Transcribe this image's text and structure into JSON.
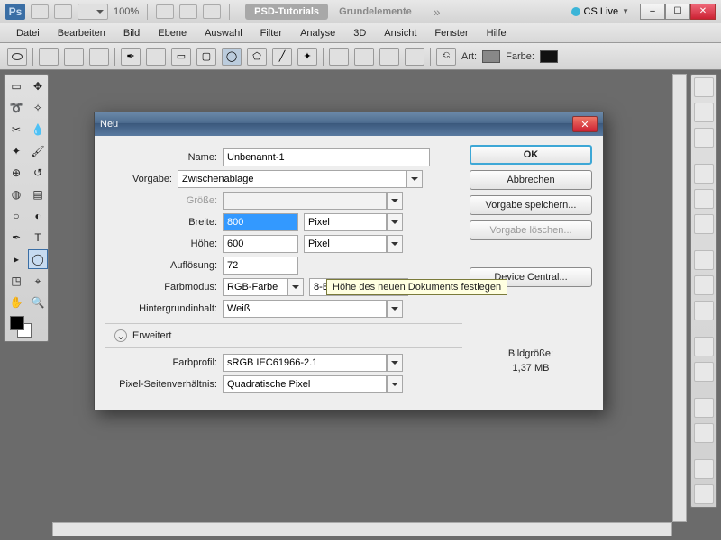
{
  "appbar": {
    "zoom": "100%",
    "tab_active": "PSD-Tutorials",
    "tab_inactive": "Grundelemente",
    "cslive": "CS Live"
  },
  "menubar": [
    "Datei",
    "Bearbeiten",
    "Bild",
    "Ebene",
    "Auswahl",
    "Filter",
    "Analyse",
    "3D",
    "Ansicht",
    "Fenster",
    "Hilfe"
  ],
  "optbar": {
    "art": "Art:",
    "farbe": "Farbe:"
  },
  "dialog": {
    "title": "Neu",
    "labels": {
      "name": "Name:",
      "vorgabe": "Vorgabe:",
      "groesse": "Größe:",
      "breite": "Breite:",
      "hoehe": "Höhe:",
      "aufloesung": "Auflösung:",
      "farbmodus": "Farbmodus:",
      "hintergrund": "Hintergrundinhalt:",
      "erweitert": "Erweitert",
      "farbprofil": "Farbprofil:",
      "pixelsv": "Pixel-Seitenverhältnis:"
    },
    "values": {
      "name": "Unbenannt-1",
      "vorgabe": "Zwischenablage",
      "breite": "800",
      "hoehe": "600",
      "aufloesung": "72",
      "unit_px": "Pixel",
      "farbmodus": "RGB-Farbe",
      "bit": "8-Bit",
      "hintergrund": "Weiß",
      "farbprofil": "sRGB IEC61966-2.1",
      "pixelsv": "Quadratische Pixel"
    },
    "buttons": {
      "ok": "OK",
      "cancel": "Abbrechen",
      "save_preset": "Vorgabe speichern...",
      "delete_preset": "Vorgabe löschen...",
      "device_central": "Device Central..."
    },
    "size_label": "Bildgröße:",
    "size_value": "1,37 MB",
    "tooltip": "Höhe des neuen Dokuments festlegen"
  }
}
